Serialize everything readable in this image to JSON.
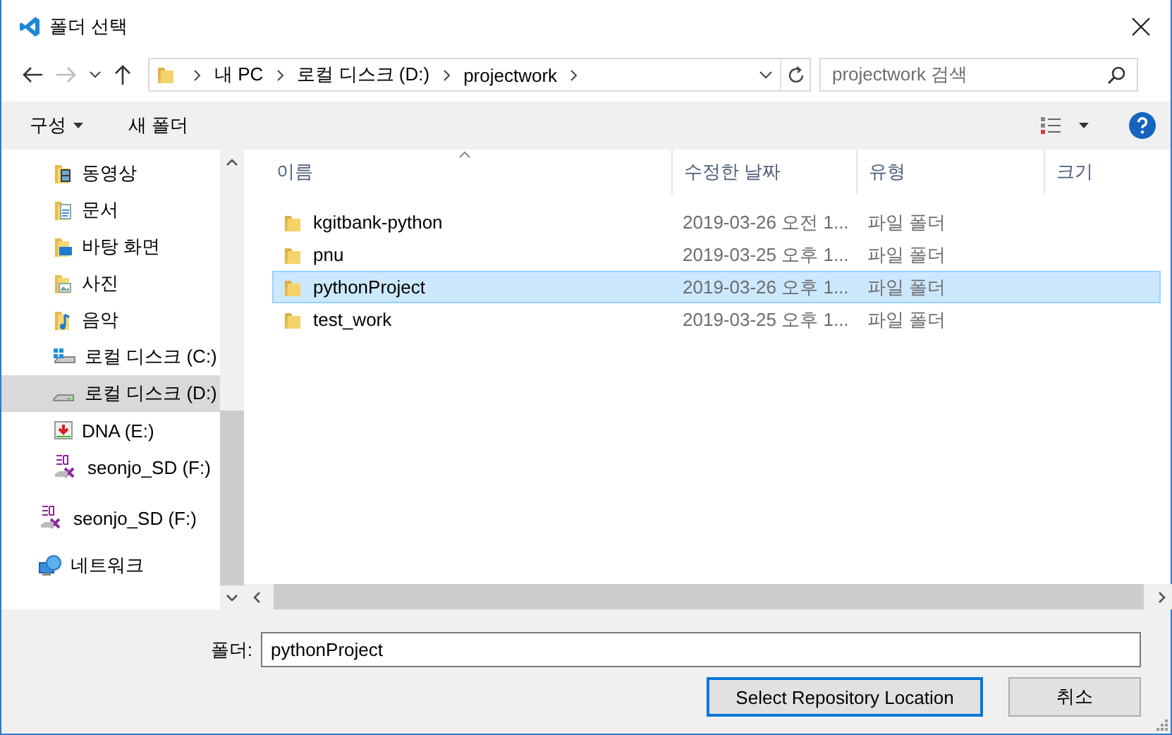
{
  "window": {
    "title": "폴더 선택"
  },
  "address": {
    "crumbs": [
      "내 PC",
      "로컬 디스크 (D:)",
      "projectwork"
    ]
  },
  "search": {
    "placeholder": "projectwork 검색"
  },
  "toolbar": {
    "organize": "구성",
    "new_folder": "새 폴더"
  },
  "sidebar": {
    "pc_items": [
      {
        "label": "동영상",
        "kind": "video",
        "selected": false
      },
      {
        "label": "문서",
        "kind": "document",
        "selected": false
      },
      {
        "label": "바탕 화면",
        "kind": "desktop",
        "selected": false
      },
      {
        "label": "사진",
        "kind": "pictures",
        "selected": false
      },
      {
        "label": "음악",
        "kind": "music",
        "selected": false
      },
      {
        "label": "로컬 디스크 (C:)",
        "kind": "windrive",
        "selected": false
      },
      {
        "label": "로컬 디스크 (D:)",
        "kind": "drive",
        "selected": true
      },
      {
        "label": "DNA (E:)",
        "kind": "usb",
        "selected": false
      },
      {
        "label": "seonjo_SD (F:)",
        "kind": "sd",
        "selected": false
      }
    ],
    "root_items": [
      {
        "label": "seonjo_SD (F:)",
        "kind": "sd",
        "selected": false
      },
      {
        "label": "네트워크",
        "kind": "network",
        "selected": false
      }
    ]
  },
  "table": {
    "columns": [
      "이름",
      "수정한 날짜",
      "유형",
      "크기"
    ],
    "rows": [
      {
        "name": "kgitbank-python",
        "modified": "2019-03-26 오전 1...",
        "type": "파일 폴더",
        "selected": false
      },
      {
        "name": "pnu",
        "modified": "2019-03-25 오후 1...",
        "type": "파일 폴더",
        "selected": false
      },
      {
        "name": "pythonProject",
        "modified": "2019-03-26 오후 1...",
        "type": "파일 폴더",
        "selected": true
      },
      {
        "name": "test_work",
        "modified": "2019-03-25 오후 1...",
        "type": "파일 폴더",
        "selected": false
      }
    ]
  },
  "footer": {
    "folder_label": "폴더:",
    "folder_value": "pythonProject",
    "ok": "Select Repository Location",
    "cancel": "취소"
  }
}
